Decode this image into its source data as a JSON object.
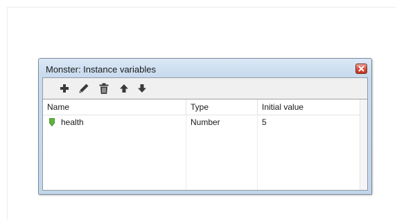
{
  "window": {
    "title": "Monster: Instance variables"
  },
  "toolbar": {
    "buttons": [
      {
        "icon": "add-icon"
      },
      {
        "icon": "edit-pencil-icon"
      },
      {
        "icon": "delete-trash-icon"
      },
      {
        "icon": "move-up-icon"
      },
      {
        "icon": "move-down-icon"
      }
    ]
  },
  "table": {
    "columns": [
      "Name",
      "Type",
      "Initial value"
    ],
    "rows": [
      {
        "icon": "variable-icon",
        "name": "health",
        "type": "Number",
        "initial_value": "5"
      }
    ]
  },
  "colors": {
    "titlebar": "#c9dbee",
    "close_button": "#d7513f",
    "variable_icon": "#5fb43a"
  }
}
